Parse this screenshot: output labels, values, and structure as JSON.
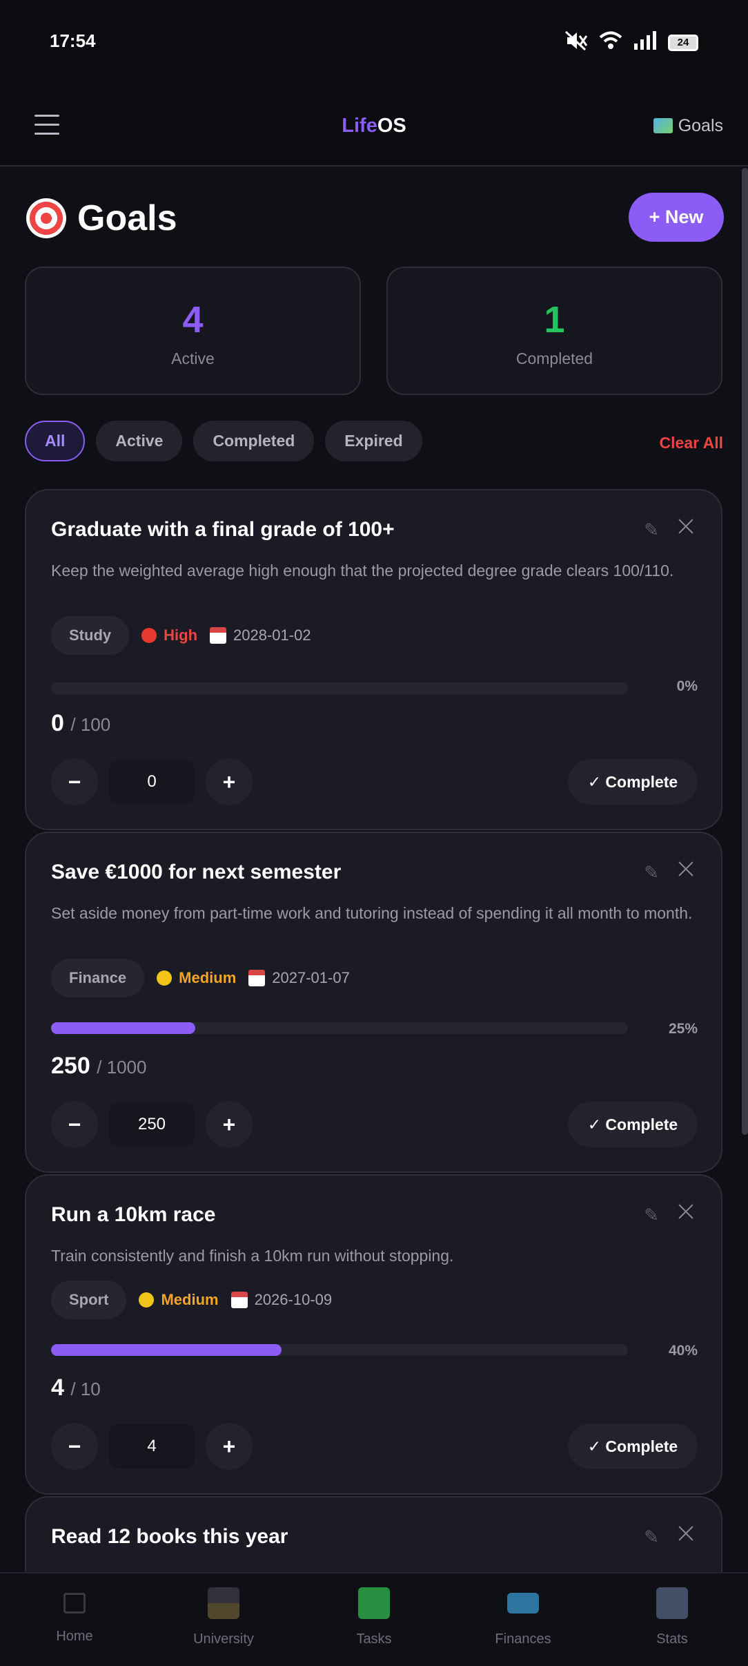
{
  "status_bar": {
    "time": "17:54",
    "battery": "24"
  },
  "header": {
    "brand_part1": "Life",
    "brand_part2": "OS",
    "current_section": "Goals"
  },
  "page": {
    "title": "Goals",
    "new_button": "+ New"
  },
  "stats": {
    "active_count": "4",
    "active_label": "Active",
    "completed_count": "1",
    "completed_label": "Completed"
  },
  "filters": {
    "all": "All",
    "active": "Active",
    "completed": "Completed",
    "expired": "Expired",
    "clear_all": "Clear All",
    "selected": "All"
  },
  "goals": [
    {
      "title": "Graduate with a final grade of 100+",
      "description": "Keep the weighted average high enough that the projected degree grade clears 100/110.",
      "category": "Study",
      "priority": "High",
      "due_date": "2028-01-02",
      "progress_fraction": 0.0,
      "progress_pct": "0%",
      "current": "0",
      "target": "/ 100",
      "input_value": "0",
      "complete_label": "✓ Complete"
    },
    {
      "title": "Save €1000 for next semester",
      "description": "Set aside money from part-time work and tutoring instead of spending it all month to month.",
      "category": "Finance",
      "priority": "Medium",
      "due_date": "2027-01-07",
      "progress_fraction": 0.25,
      "progress_pct": "25%",
      "current": "250",
      "target": "/ 1000",
      "input_value": "250",
      "complete_label": "✓ Complete"
    },
    {
      "title": "Run a 10km race",
      "description": "Train consistently and finish a 10km run without stopping.",
      "category": "Sport",
      "priority": "Medium",
      "due_date": "2026-10-09",
      "progress_fraction": 0.4,
      "progress_pct": "40%",
      "current": "4",
      "target": "/ 10",
      "input_value": "4",
      "complete_label": "✓ Complete"
    },
    {
      "title": "Read 12 books this year"
    }
  ],
  "bottom_nav": {
    "home": "Home",
    "university": "University",
    "tasks": "Tasks",
    "finances": "Finances",
    "stats": "Stats"
  },
  "colors": {
    "accent": "#8b5cf6",
    "success": "#22c55e",
    "danger": "#ef4444",
    "warning": "#f5a524",
    "background": "#0f0f16"
  }
}
